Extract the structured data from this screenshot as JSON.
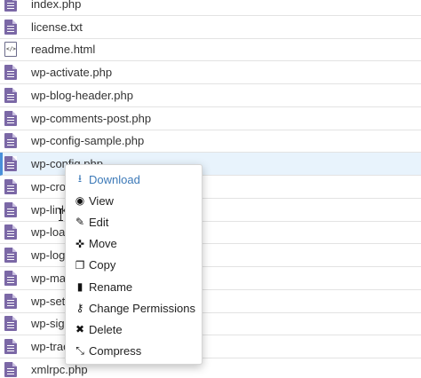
{
  "files": [
    {
      "name": "index.php",
      "type": "php"
    },
    {
      "name": "license.txt",
      "type": "txt"
    },
    {
      "name": "readme.html",
      "type": "html"
    },
    {
      "name": "wp-activate.php",
      "type": "php"
    },
    {
      "name": "wp-blog-header.php",
      "type": "php"
    },
    {
      "name": "wp-comments-post.php",
      "type": "php"
    },
    {
      "name": "wp-config-sample.php",
      "type": "php"
    },
    {
      "name": "wp-config.php",
      "type": "php"
    },
    {
      "name": "wp-cron.php",
      "type": "php"
    },
    {
      "name": "wp-links-opml.php",
      "type": "php"
    },
    {
      "name": "wp-load.php",
      "type": "php"
    },
    {
      "name": "wp-login.php",
      "type": "php"
    },
    {
      "name": "wp-mail.php",
      "type": "php"
    },
    {
      "name": "wp-settings.php",
      "type": "php"
    },
    {
      "name": "wp-signup.php",
      "type": "php"
    },
    {
      "name": "wp-trackback.php",
      "type": "php"
    },
    {
      "name": "xmlrpc.php",
      "type": "php"
    }
  ],
  "visible_names": [
    "index.php",
    "license.txt",
    "readme.html",
    "wp-activate.php",
    "wp-blog-header.php",
    "wp-comments-post.php",
    "wp-config-sample.php",
    "wp-config.php",
    "wp-cro",
    "wp-link",
    "wp-loa",
    "wp-logi",
    "wp-mai",
    "wp-sett",
    "wp-sign",
    "wp-trac",
    "xmlrpc.php"
  ],
  "selected_index": 7,
  "context_menu": {
    "items": [
      {
        "label": "Download",
        "icon": "download-icon",
        "glyph": "⭳"
      },
      {
        "label": "View",
        "icon": "eye-icon",
        "glyph": "◉"
      },
      {
        "label": "Edit",
        "icon": "pencil-icon",
        "glyph": "✎"
      },
      {
        "label": "Move",
        "icon": "move-arrows-icon",
        "glyph": "✜"
      },
      {
        "label": "Copy",
        "icon": "copy-icon",
        "glyph": "❐"
      },
      {
        "label": "Rename",
        "icon": "file-icon",
        "glyph": "▮"
      },
      {
        "label": "Change Permissions",
        "icon": "key-icon",
        "glyph": "⚷"
      },
      {
        "label": "Delete",
        "icon": "close-x-icon",
        "glyph": "✖"
      },
      {
        "label": "Compress",
        "icon": "compress-icon",
        "glyph": "⤡"
      }
    ]
  },
  "colors": {
    "selected_row_bg": "#e8f3fc",
    "menu_active": "#3d7ab8",
    "php_icon": "#7b68a6"
  }
}
